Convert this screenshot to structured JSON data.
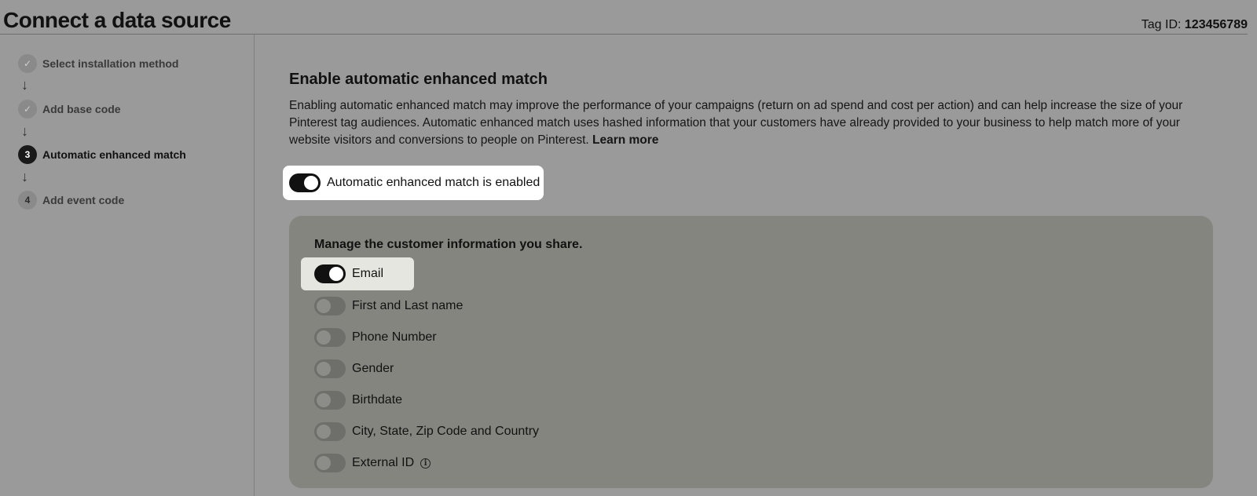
{
  "header": {
    "title": "Connect a data source",
    "tag_id_label": "Tag ID:",
    "tag_id_value": "123456789"
  },
  "steps": [
    {
      "number": "✓",
      "label": "Select installation method",
      "state": "done"
    },
    {
      "number": "✓",
      "label": "Add base code",
      "state": "done"
    },
    {
      "number": "3",
      "label": "Automatic enhanced match",
      "state": "active"
    },
    {
      "number": "4",
      "label": "Add event code",
      "state": "pending"
    }
  ],
  "step_arrow": "↓",
  "section": {
    "title": "Enable automatic enhanced match",
    "description": "Enabling automatic enhanced match may improve the performance of your campaigns (return on ad spend and cost per action) and can help increase the size of your Pinterest tag audiences. Automatic enhanced match uses hashed information that your customers have already provided to your business to help match more of your website visitors and conversions to people on Pinterest.",
    "learn_more": "Learn more"
  },
  "master_toggle": {
    "label": "Automatic enhanced match is enabled",
    "on": true
  },
  "panel": {
    "title": "Manage the customer information you share.",
    "options": [
      {
        "label": "Email",
        "on": true
      },
      {
        "label": "First and Last name",
        "on": false
      },
      {
        "label": "Phone Number",
        "on": false
      },
      {
        "label": "Gender",
        "on": false
      },
      {
        "label": "Birthdate",
        "on": false
      },
      {
        "label": "City, State, Zip Code and Country",
        "on": false
      },
      {
        "label": "External ID",
        "on": false
      }
    ],
    "info_icon": "i"
  },
  "colors": {
    "background": "#9a9a9a",
    "panel": "#858580",
    "toggle_on": "#111111",
    "toggle_off": "#6e6e6a"
  }
}
